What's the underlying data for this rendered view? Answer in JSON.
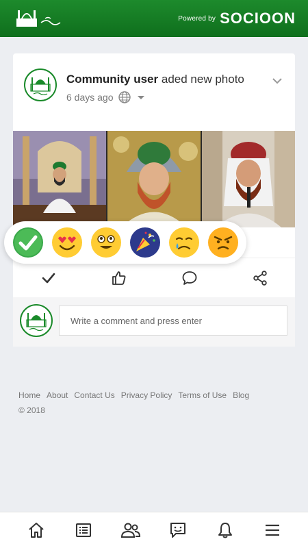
{
  "header": {
    "logo_icon": "mosque-icon",
    "powered_by": "Powered by",
    "brand": "SOCIOON",
    "brand_color": "#1a8a2a"
  },
  "post": {
    "user": "Community user",
    "action": "aded new photo",
    "time": "6 days ago",
    "privacy_icon": "globe-icon",
    "menu_icon": "chevron-down-icon"
  },
  "reactions": [
    {
      "name": "check-reaction",
      "color": "#3aa84a"
    },
    {
      "name": "love-reaction",
      "color": "#ffcc33"
    },
    {
      "name": "wow-reaction",
      "color": "#ffcc33"
    },
    {
      "name": "party-reaction",
      "color": "#2d3a8c"
    },
    {
      "name": "sad-reaction",
      "color": "#ffcc33"
    },
    {
      "name": "angry-reaction",
      "color": "#ffb020"
    }
  ],
  "actions": [
    "check-icon",
    "thumbs-up-icon",
    "comment-bubble-icon",
    "share-icon"
  ],
  "comment": {
    "placeholder": "Write a comment and press enter"
  },
  "footer": {
    "links": [
      "Home",
      "About",
      "Contact Us",
      "Privacy Policy",
      "Terms of Use",
      "Blog"
    ],
    "copyright": "© 2018"
  },
  "bottom_nav": [
    "home-icon",
    "news-feed-icon",
    "people-icon",
    "messages-icon",
    "notifications-icon",
    "menu-icon"
  ]
}
